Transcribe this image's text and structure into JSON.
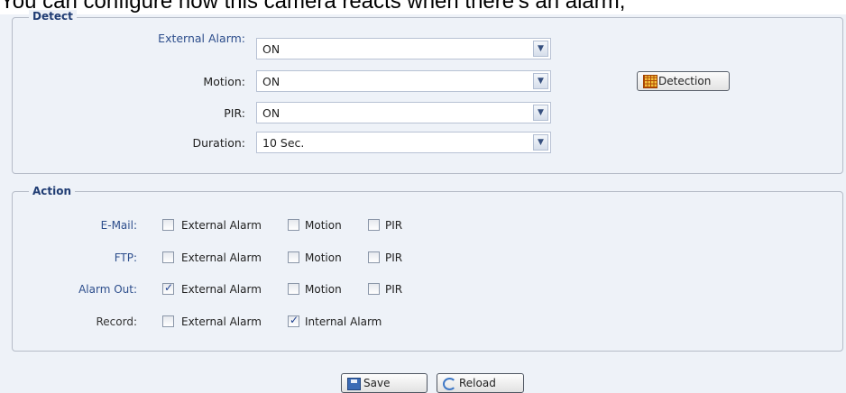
{
  "caption": "You can configure how this camera reacts when there's an alarm,",
  "detect": {
    "legend": "Detect",
    "rows": [
      {
        "label": "External Alarm:",
        "value": "ON"
      },
      {
        "label": "Motion:",
        "value": "ON"
      },
      {
        "label": "PIR:",
        "value": "ON"
      },
      {
        "label": "Duration:",
        "value": "10 Sec."
      }
    ],
    "detection_button": "Detection"
  },
  "action": {
    "legend": "Action",
    "rows": [
      {
        "label": "E-Mail:",
        "options": [
          {
            "text": "External Alarm",
            "checked": false
          },
          {
            "text": "Motion",
            "checked": false
          },
          {
            "text": "PIR",
            "checked": false
          }
        ]
      },
      {
        "label": "FTP:",
        "options": [
          {
            "text": "External Alarm",
            "checked": false
          },
          {
            "text": "Motion",
            "checked": false
          },
          {
            "text": "PIR",
            "checked": false
          }
        ]
      },
      {
        "label": "Alarm Out:",
        "options": [
          {
            "text": "External Alarm",
            "checked": true
          },
          {
            "text": "Motion",
            "checked": false
          },
          {
            "text": "PIR",
            "checked": false
          }
        ]
      },
      {
        "label": "Record:",
        "options": [
          {
            "text": "External Alarm",
            "checked": false
          },
          {
            "text": "Internal Alarm",
            "checked": true
          }
        ]
      }
    ]
  },
  "footer": {
    "save": "Save",
    "reload": "Reload"
  },
  "colors": {
    "label_blue": "#2d4e8c",
    "panel_bg": "#eef2f8",
    "border": "#b6bcc8"
  }
}
